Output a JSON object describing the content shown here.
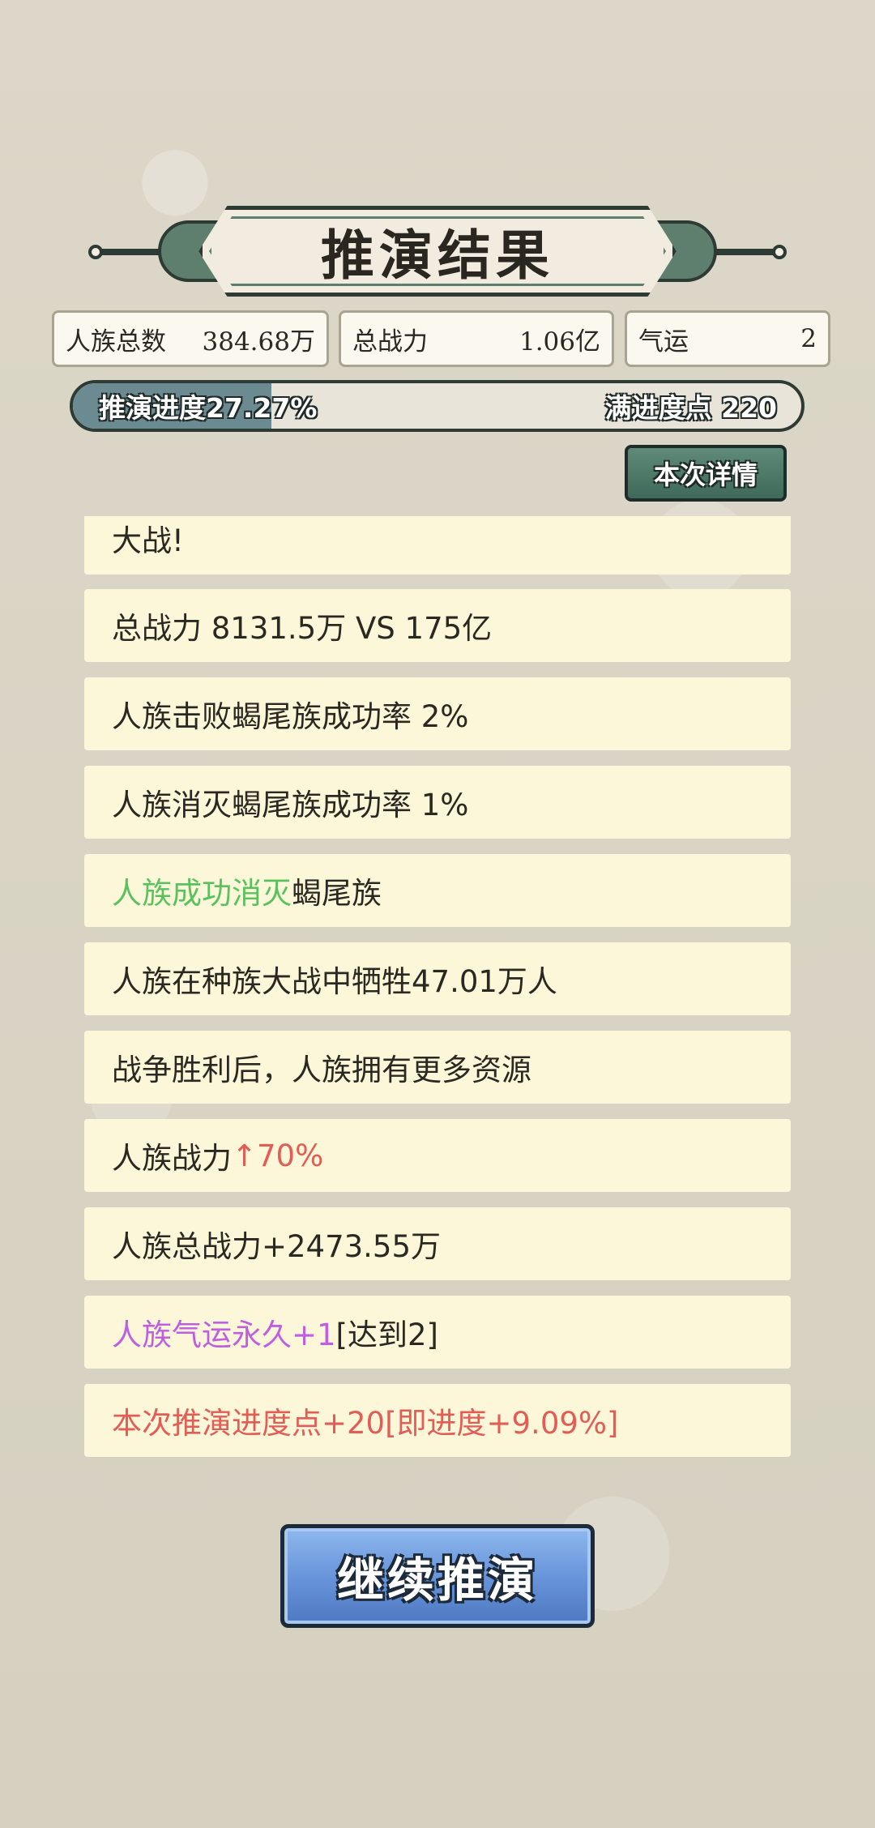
{
  "title": "推演结果",
  "stats": [
    {
      "label": "人族总数",
      "value": "384.68万"
    },
    {
      "label": "总战力",
      "value": "1.06亿"
    },
    {
      "label": "气运",
      "value": "2"
    }
  ],
  "progress": {
    "label": "推演进度27.27%",
    "percent": 27.27,
    "full_label": "满进度点 220"
  },
  "details_button": "本次详情",
  "log": {
    "item0": "大战!",
    "item1": "总战力 8131.5万 VS 175亿",
    "item2": "人族击败蝎尾族成功率 2%",
    "item3": "人族消灭蝎尾族成功率 1%",
    "item4_green": "人族成功消灭",
    "item4_rest": "蝎尾族",
    "item5": "人族在种族大战中牺牲47.01万人",
    "item6": "战争胜利后，人族拥有更多资源",
    "item7_prefix": "人族战力",
    "item7_red": "↑70%",
    "item8": "人族总战力+2473.55万",
    "item9_purple": "人族气运永久+1",
    "item9_rest": "[达到2]",
    "item10": "本次推演进度点+20[即进度+9.09%]"
  },
  "continue_button": "继续推演",
  "colors": {
    "green": "#59c25f",
    "red": "#e25d55",
    "purple": "#bd5fe0",
    "progress_fill": "#6b8a91",
    "button_blue": "#6592d8"
  }
}
